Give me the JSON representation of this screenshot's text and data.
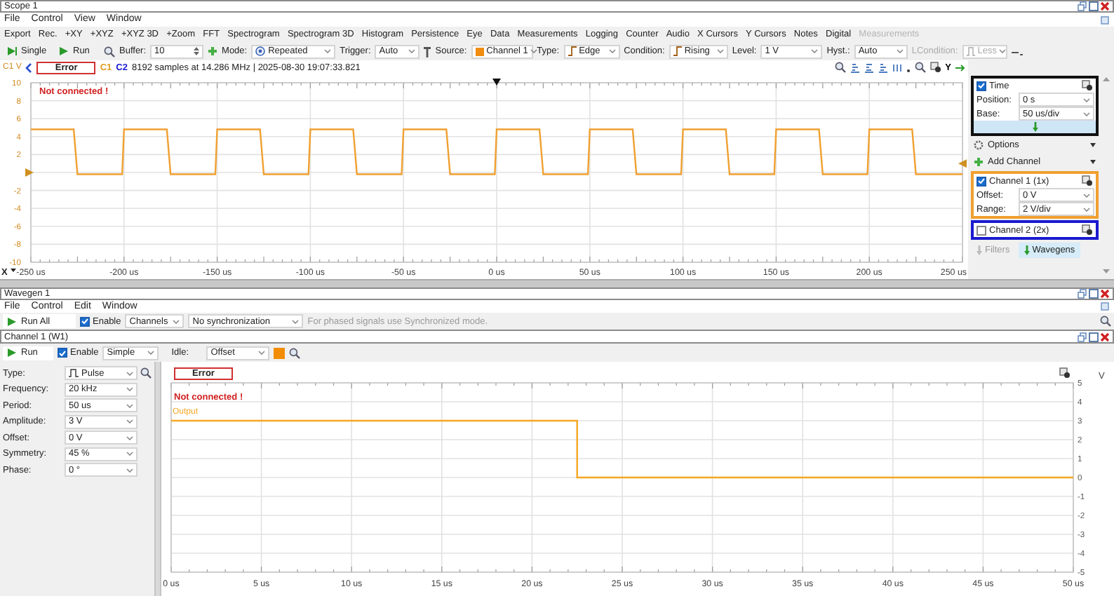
{
  "scope": {
    "title": "Scope 1",
    "menu": [
      "File",
      "Control",
      "View",
      "Window"
    ],
    "tools": [
      {
        "label": "Export",
        "disabled": false
      },
      {
        "label": "Rec.",
        "disabled": false
      },
      {
        "label": "+XY",
        "disabled": false
      },
      {
        "label": "+XYZ",
        "disabled": false
      },
      {
        "label": "+XYZ 3D",
        "disabled": false
      },
      {
        "label": "+Zoom",
        "disabled": false
      },
      {
        "label": "FFT",
        "disabled": false
      },
      {
        "label": "Spectrogram",
        "disabled": false
      },
      {
        "label": "Spectrogram 3D",
        "disabled": false
      },
      {
        "label": "Histogram",
        "disabled": false
      },
      {
        "label": "Persistence",
        "disabled": false
      },
      {
        "label": "Eye",
        "disabled": false
      },
      {
        "label": "Data",
        "disabled": false
      },
      {
        "label": "Measurements",
        "disabled": false
      },
      {
        "label": "Logging",
        "disabled": false
      },
      {
        "label": "Counter",
        "disabled": false
      },
      {
        "label": "Audio",
        "disabled": false
      },
      {
        "label": "X Cursors",
        "disabled": false
      },
      {
        "label": "Y Cursors",
        "disabled": false
      },
      {
        "label": "Notes",
        "disabled": false
      },
      {
        "label": "Digital",
        "disabled": false
      },
      {
        "label": "Measurements",
        "disabled": true
      }
    ],
    "toolbar": {
      "single": "Single",
      "run": "Run",
      "buffer_label": "Buffer:",
      "buffer": "10",
      "mode_label": "Mode:",
      "mode": "Repeated",
      "trigger_label": "Trigger:",
      "trigger": "Auto",
      "source_label": "Source:",
      "source": "Channel 1",
      "type_label": "Type:",
      "type": "Edge",
      "condition_label": "Condition:",
      "condition": "Rising",
      "level_label": "Level:",
      "level": "1 V",
      "hyst_label": "Hyst.:",
      "hyst": "Auto",
      "lcondition_label": "LCondition:",
      "lcondition": "Less",
      "lcondition_disabled": true
    },
    "status": {
      "error": "Error",
      "message": "Not connected !",
      "c1": "C1",
      "c2": "C2",
      "info": "8192 samples at 14.286 MHz | 2025-08-30 19:07:33.821"
    },
    "x_axis_button": "X",
    "y_axis_button": "Y",
    "chart_data": {
      "type": "line",
      "grid": true,
      "ylabel": "C1 V",
      "x": [
        -250,
        -227,
        -225,
        -201,
        -200,
        -177,
        -175,
        -151,
        -150,
        -127,
        -125,
        -101,
        -100,
        -77,
        -75,
        -51,
        -50,
        -27,
        -25,
        -1,
        0,
        23,
        25,
        49,
        50,
        73,
        75,
        99,
        100,
        123,
        125,
        149,
        150,
        173,
        175,
        199,
        200,
        223,
        225,
        250
      ],
      "series": [
        {
          "color": "#f0a030",
          "values": [
            4.8,
            4.8,
            -0.2,
            -0.2,
            4.8,
            4.8,
            -0.2,
            -0.2,
            4.8,
            4.8,
            -0.2,
            -0.2,
            4.8,
            4.8,
            -0.2,
            -0.2,
            4.8,
            4.8,
            -0.2,
            -0.2,
            4.8,
            4.8,
            -0.2,
            -0.2,
            4.8,
            4.8,
            -0.2,
            -0.2,
            4.8,
            4.8,
            -0.2,
            -0.2,
            4.8,
            4.8,
            -0.2,
            -0.2,
            4.8,
            4.8,
            -0.2,
            -0.2
          ]
        }
      ],
      "xlim": [
        -250,
        250
      ],
      "ylim": [
        -10,
        10
      ],
      "xticks": [
        {
          "value": -250,
          "label": "-250 us"
        },
        {
          "value": -200,
          "label": "-200 us"
        },
        {
          "value": -150,
          "label": "-150 us"
        },
        {
          "value": -100,
          "label": "-100 us"
        },
        {
          "value": -50,
          "label": "-50 us"
        },
        {
          "value": 0,
          "label": "0 us"
        },
        {
          "value": 50,
          "label": "50 us"
        },
        {
          "value": 100,
          "label": "100 us"
        },
        {
          "value": 150,
          "label": "150 us"
        },
        {
          "value": 200,
          "label": "200 us"
        },
        {
          "value": 250,
          "label": "250 us"
        }
      ],
      "yticks": [
        10,
        8,
        6,
        4,
        2,
        -2,
        -4,
        -6,
        -8,
        -10
      ]
    },
    "panel": {
      "time": {
        "title": "Time",
        "checked": true,
        "rows": [
          {
            "label": "Position:",
            "value": "0 s"
          },
          {
            "label": "Base:",
            "value": "50 us/div"
          }
        ]
      },
      "options": "Options",
      "add_channel": "Add Channel",
      "channels": [
        {
          "title": "Channel 1 (1x)",
          "checked": true,
          "color": "#f0a030",
          "rows": [
            {
              "label": "Offset:",
              "value": "0 V"
            },
            {
              "label": "Range:",
              "value": "2 V/div"
            }
          ]
        },
        {
          "title": "Channel 2 (2x)",
          "checked": false,
          "color": "#1a1ad0"
        }
      ],
      "tabs": [
        {
          "label": "Filters",
          "selected": false
        },
        {
          "label": "Wavegens",
          "selected": true
        }
      ]
    }
  },
  "wavegen": {
    "title": "Wavegen 1",
    "menu": [
      "File",
      "Control",
      "Edit",
      "Window"
    ],
    "toolbar": {
      "run_all": "Run All",
      "enable": "Enable",
      "enable_checked": true,
      "channels": "Channels",
      "sync": "No synchronization",
      "hint": "For phased signals use Synchronized mode."
    },
    "channel": {
      "title": "Channel 1 (W1)",
      "run": "Run",
      "enable": "Enable",
      "enable_checked": true,
      "mode": "Simple",
      "idle_label": "Idle:",
      "idle": "Offset",
      "params": [
        {
          "label": "Type:",
          "value": "Pulse"
        },
        {
          "label": "Frequency:",
          "value": "20 kHz"
        },
        {
          "label": "Period:",
          "value": "50 us"
        },
        {
          "label": "Amplitude:",
          "value": "3 V"
        },
        {
          "label": "Offset:",
          "value": "0 V"
        },
        {
          "label": "Symmetry:",
          "value": "45 %"
        },
        {
          "label": "Phase:",
          "value": "0 °"
        }
      ],
      "error": "Error",
      "message": "Not connected !",
      "chart_data": {
        "type": "line",
        "grid": true,
        "ylabel": "V",
        "x": [
          0,
          22.5,
          22.5,
          50
        ],
        "series": [
          {
            "name": "Output",
            "color": "#f5a623",
            "values": [
              3,
              3,
              0,
              0
            ]
          }
        ],
        "xlim": [
          0,
          50
        ],
        "ylim": [
          -5,
          5
        ],
        "xticks": [
          {
            "value": 0,
            "label": "0 us"
          },
          {
            "value": 5,
            "label": "5 us"
          },
          {
            "value": 10,
            "label": "10 us"
          },
          {
            "value": 15,
            "label": "15 us"
          },
          {
            "value": 20,
            "label": "20 us"
          },
          {
            "value": 25,
            "label": "25 us"
          },
          {
            "value": 30,
            "label": "30 us"
          },
          {
            "value": 35,
            "label": "35 us"
          },
          {
            "value": 40,
            "label": "40 us"
          },
          {
            "value": 45,
            "label": "45 us"
          },
          {
            "value": 50,
            "label": "50 us"
          }
        ],
        "yticks": [
          5,
          4,
          3,
          2,
          1,
          0,
          -1,
          -2,
          -3,
          -4,
          -5
        ]
      }
    }
  }
}
